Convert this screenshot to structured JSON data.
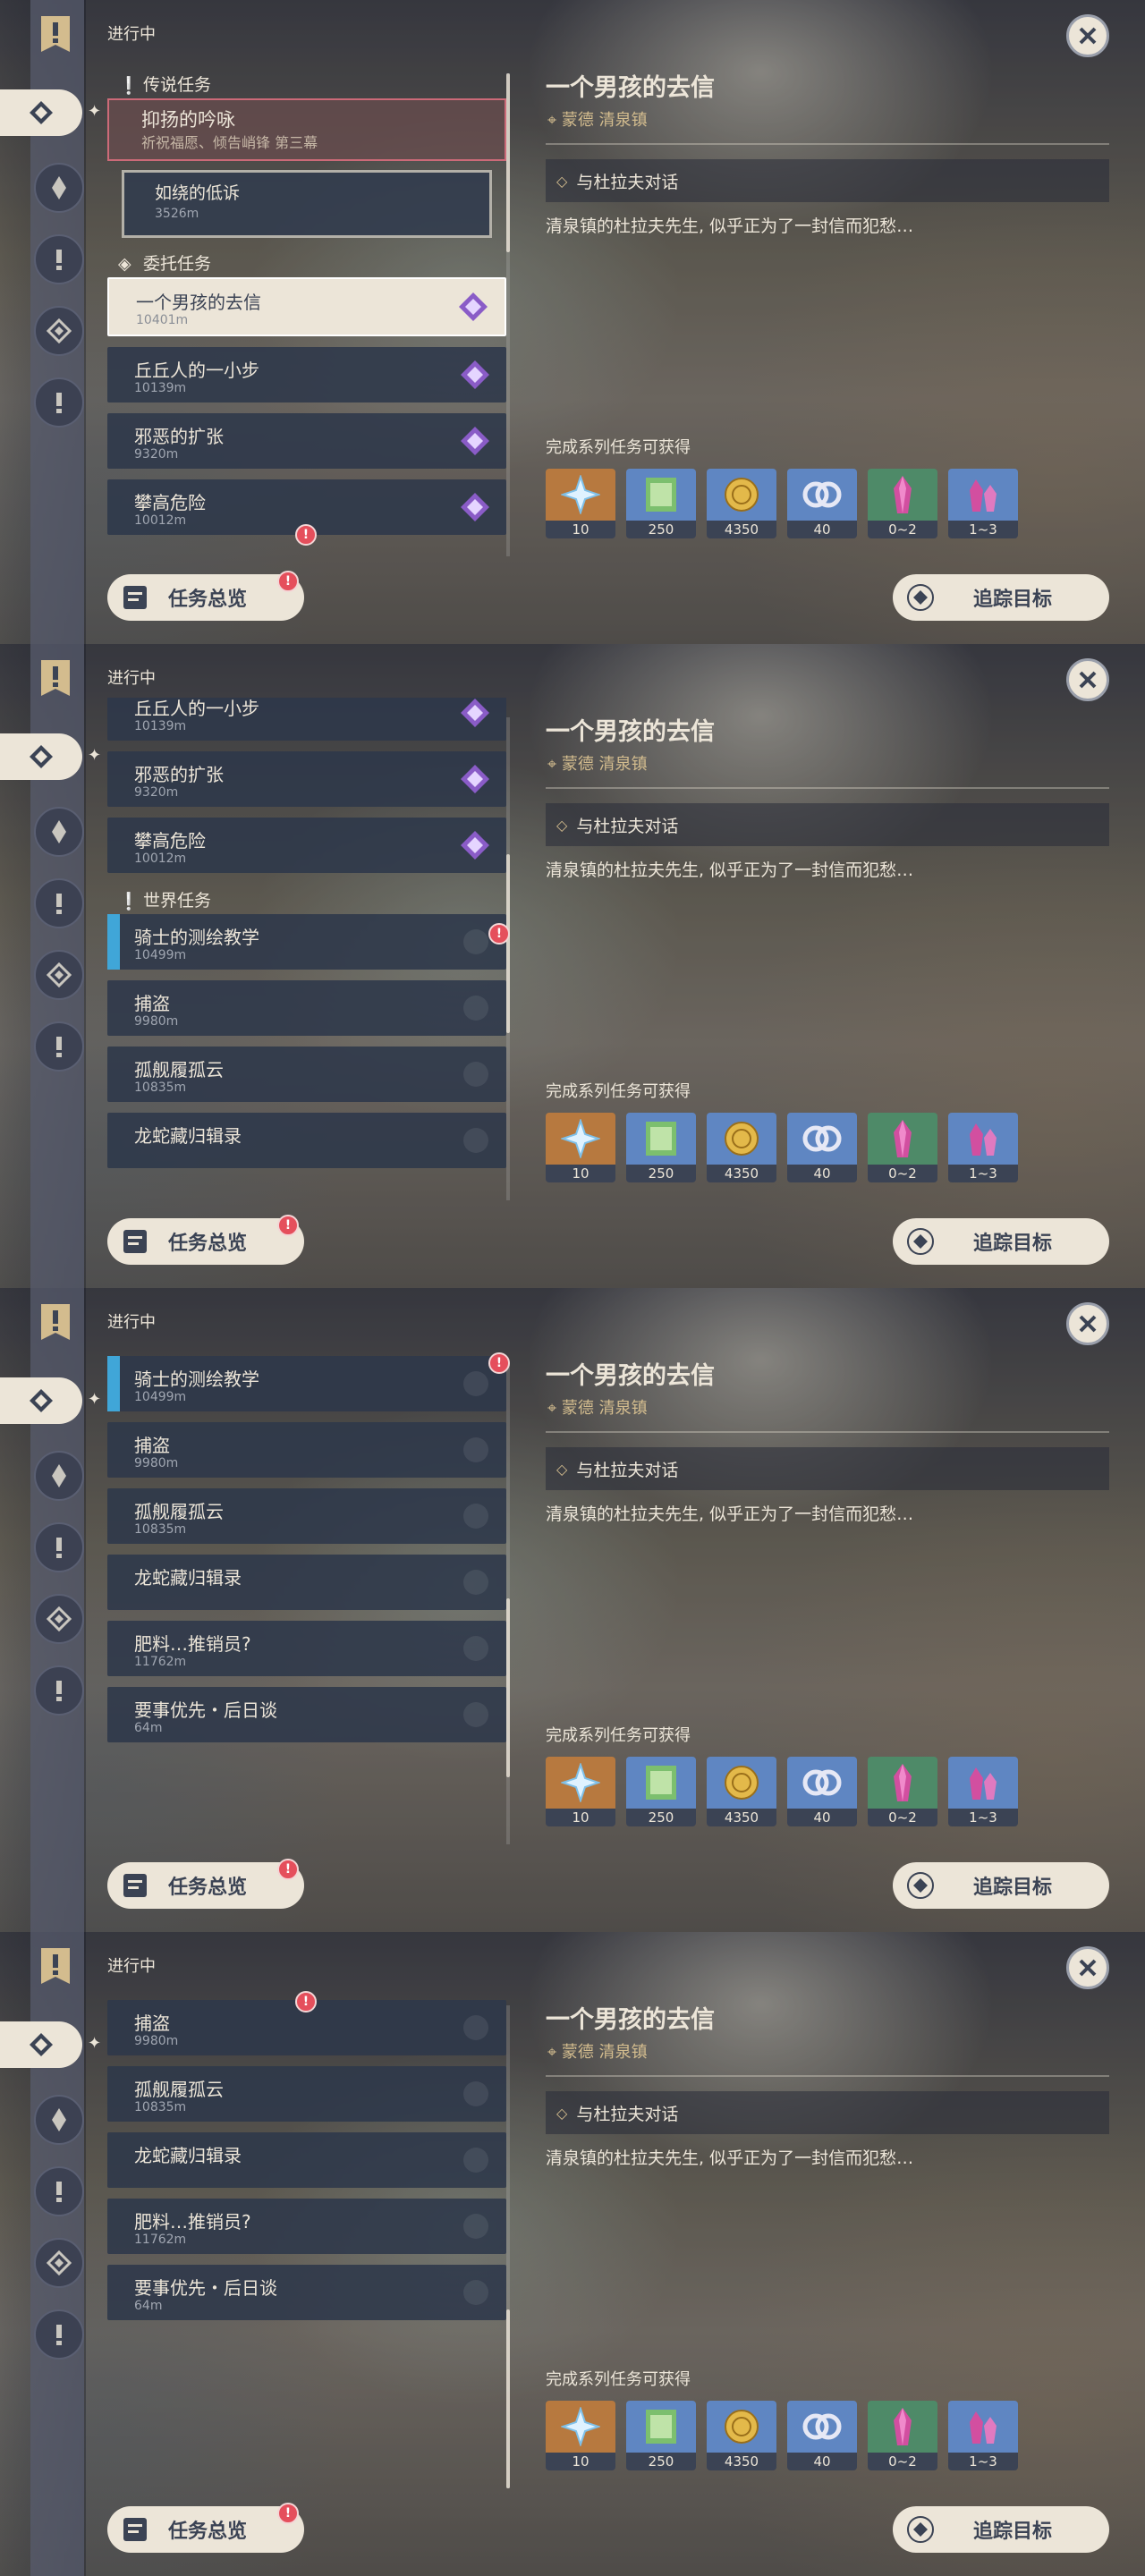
{
  "status_label": "进行中",
  "sections": {
    "legend": "传说任务",
    "commission": "委托任务",
    "world": "世界任务"
  },
  "legend_quest": {
    "title": "抑扬的吟咏",
    "subtitle": "祈祝福愿、倾告峭锋 第三幕"
  },
  "legend_subquest": {
    "title": "如绕的低诉",
    "distance": "3526m"
  },
  "quests": [
    {
      "title": "一个男孩的去信",
      "distance": "10401m"
    },
    {
      "title": "丘丘人的一小步",
      "distance": "10139m"
    },
    {
      "title": "邪恶的扩张",
      "distance": "9320m"
    },
    {
      "title": "攀高危险",
      "distance": "10012m"
    },
    {
      "title": "骑士的测绘教学",
      "distance": "10499m"
    },
    {
      "title": "捕盗",
      "distance": "9980m"
    },
    {
      "title": "孤舰履孤云",
      "distance": "10835m"
    },
    {
      "title": "龙蛇藏归辑录",
      "distance": ""
    },
    {
      "title": "肥料…推销员?",
      "distance": "11762m"
    },
    {
      "title": "要事优先・后日谈",
      "distance": "64m"
    }
  ],
  "detail": {
    "title": "一个男孩的去信",
    "region": "蒙德 清泉镇",
    "objective": "与杜拉夫对话",
    "description": "清泉镇的杜拉夫先生, 似乎正为了一封信而犯愁…",
    "reward_label": "完成系列任务可获得",
    "rewards": [
      {
        "name": "primogem",
        "count": "10",
        "bg": "#b7793f"
      },
      {
        "name": "adventure-exp",
        "count": "250",
        "bg": "#5f86c2"
      },
      {
        "name": "mora",
        "count": "4350",
        "bg": "#5f86c2"
      },
      {
        "name": "companionship-exp",
        "count": "40",
        "bg": "#5f86c2"
      },
      {
        "name": "crystal-chunk",
        "count": "0~2",
        "bg": "#4e8a68"
      },
      {
        "name": "crystal-ore",
        "count": "1~3",
        "bg": "#5f86c2"
      }
    ]
  },
  "buttons": {
    "quest_overview": "任务总览",
    "track_target": "追踪目标"
  },
  "alert_mark": "!",
  "scroll_progress": [
    0.0,
    0.45,
    0.78,
    1.0
  ],
  "colors": {
    "cream": "#ece5d8",
    "slate": "#3b4354",
    "commission_purple": "#8a5cc7",
    "world_blue": "#40a6d8"
  }
}
